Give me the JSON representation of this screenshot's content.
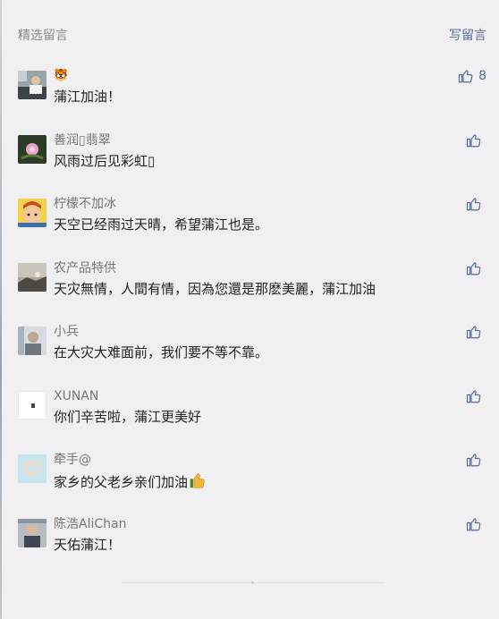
{
  "header": {
    "title": "精选留言",
    "write_label": "写留言"
  },
  "comments": [
    {
      "nickname": "🐯",
      "text": "蒲江加油！",
      "likes": "8",
      "avatar": "portrait-man-car"
    },
    {
      "nickname": "善润\u0000翡翠",
      "text": "风雨过后见彩虹\u0000",
      "likes": "",
      "avatar": "lotus-flower"
    },
    {
      "nickname": "柠檬不加冰",
      "text": "天空已经雨过天晴，希望蒲江也是。",
      "likes": "",
      "avatar": "cartoon-boy"
    },
    {
      "nickname": "农产品特供",
      "text": "天灾無情，人間有情，因為您還是那麽美麗，蒲江加油",
      "likes": "",
      "avatar": "landscape-sunset"
    },
    {
      "nickname": "小兵",
      "text": "在大灾大难面前，我们要不等不靠。",
      "likes": "",
      "avatar": "portrait-man"
    },
    {
      "nickname": "XUNAN",
      "text": "你们辛苦啦，蒲江更美好",
      "likes": "",
      "avatar": "logo-white"
    },
    {
      "nickname": "牵手@",
      "text": "家乡的父老乡亲们加油",
      "likes": "",
      "avatar": "hands-heart",
      "emoji": "thumbs-up-emoji"
    },
    {
      "nickname": "陈浩AliChan",
      "text": "天佑蒲江！",
      "likes": "",
      "avatar": "portrait-man-2"
    }
  ]
}
